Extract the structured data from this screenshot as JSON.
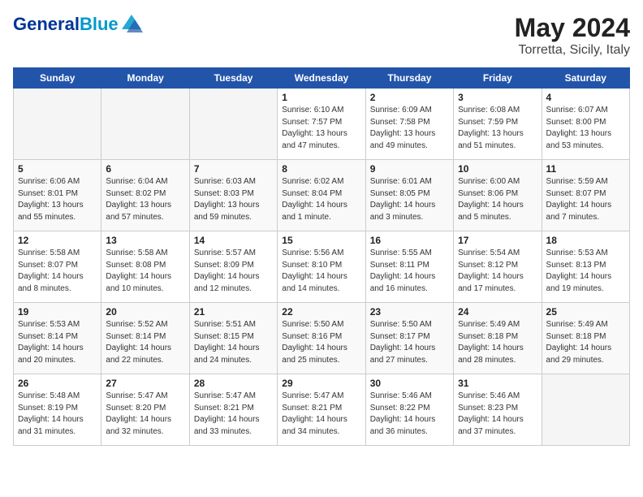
{
  "header": {
    "logo_line1": "General",
    "logo_line2": "Blue",
    "month_year": "May 2024",
    "location": "Torretta, Sicily, Italy"
  },
  "weekdays": [
    "Sunday",
    "Monday",
    "Tuesday",
    "Wednesday",
    "Thursday",
    "Friday",
    "Saturday"
  ],
  "weeks": [
    [
      {
        "day": "",
        "empty": true
      },
      {
        "day": "",
        "empty": true
      },
      {
        "day": "",
        "empty": true
      },
      {
        "day": "1",
        "sunrise": "Sunrise: 6:10 AM",
        "sunset": "Sunset: 7:57 PM",
        "daylight": "Daylight: 13 hours and 47 minutes."
      },
      {
        "day": "2",
        "sunrise": "Sunrise: 6:09 AM",
        "sunset": "Sunset: 7:58 PM",
        "daylight": "Daylight: 13 hours and 49 minutes."
      },
      {
        "day": "3",
        "sunrise": "Sunrise: 6:08 AM",
        "sunset": "Sunset: 7:59 PM",
        "daylight": "Daylight: 13 hours and 51 minutes."
      },
      {
        "day": "4",
        "sunrise": "Sunrise: 6:07 AM",
        "sunset": "Sunset: 8:00 PM",
        "daylight": "Daylight: 13 hours and 53 minutes."
      }
    ],
    [
      {
        "day": "5",
        "sunrise": "Sunrise: 6:06 AM",
        "sunset": "Sunset: 8:01 PM",
        "daylight": "Daylight: 13 hours and 55 minutes."
      },
      {
        "day": "6",
        "sunrise": "Sunrise: 6:04 AM",
        "sunset": "Sunset: 8:02 PM",
        "daylight": "Daylight: 13 hours and 57 minutes."
      },
      {
        "day": "7",
        "sunrise": "Sunrise: 6:03 AM",
        "sunset": "Sunset: 8:03 PM",
        "daylight": "Daylight: 13 hours and 59 minutes."
      },
      {
        "day": "8",
        "sunrise": "Sunrise: 6:02 AM",
        "sunset": "Sunset: 8:04 PM",
        "daylight": "Daylight: 14 hours and 1 minute."
      },
      {
        "day": "9",
        "sunrise": "Sunrise: 6:01 AM",
        "sunset": "Sunset: 8:05 PM",
        "daylight": "Daylight: 14 hours and 3 minutes."
      },
      {
        "day": "10",
        "sunrise": "Sunrise: 6:00 AM",
        "sunset": "Sunset: 8:06 PM",
        "daylight": "Daylight: 14 hours and 5 minutes."
      },
      {
        "day": "11",
        "sunrise": "Sunrise: 5:59 AM",
        "sunset": "Sunset: 8:07 PM",
        "daylight": "Daylight: 14 hours and 7 minutes."
      }
    ],
    [
      {
        "day": "12",
        "sunrise": "Sunrise: 5:58 AM",
        "sunset": "Sunset: 8:07 PM",
        "daylight": "Daylight: 14 hours and 8 minutes."
      },
      {
        "day": "13",
        "sunrise": "Sunrise: 5:58 AM",
        "sunset": "Sunset: 8:08 PM",
        "daylight": "Daylight: 14 hours and 10 minutes."
      },
      {
        "day": "14",
        "sunrise": "Sunrise: 5:57 AM",
        "sunset": "Sunset: 8:09 PM",
        "daylight": "Daylight: 14 hours and 12 minutes."
      },
      {
        "day": "15",
        "sunrise": "Sunrise: 5:56 AM",
        "sunset": "Sunset: 8:10 PM",
        "daylight": "Daylight: 14 hours and 14 minutes."
      },
      {
        "day": "16",
        "sunrise": "Sunrise: 5:55 AM",
        "sunset": "Sunset: 8:11 PM",
        "daylight": "Daylight: 14 hours and 16 minutes."
      },
      {
        "day": "17",
        "sunrise": "Sunrise: 5:54 AM",
        "sunset": "Sunset: 8:12 PM",
        "daylight": "Daylight: 14 hours and 17 minutes."
      },
      {
        "day": "18",
        "sunrise": "Sunrise: 5:53 AM",
        "sunset": "Sunset: 8:13 PM",
        "daylight": "Daylight: 14 hours and 19 minutes."
      }
    ],
    [
      {
        "day": "19",
        "sunrise": "Sunrise: 5:53 AM",
        "sunset": "Sunset: 8:14 PM",
        "daylight": "Daylight: 14 hours and 20 minutes."
      },
      {
        "day": "20",
        "sunrise": "Sunrise: 5:52 AM",
        "sunset": "Sunset: 8:14 PM",
        "daylight": "Daylight: 14 hours and 22 minutes."
      },
      {
        "day": "21",
        "sunrise": "Sunrise: 5:51 AM",
        "sunset": "Sunset: 8:15 PM",
        "daylight": "Daylight: 14 hours and 24 minutes."
      },
      {
        "day": "22",
        "sunrise": "Sunrise: 5:50 AM",
        "sunset": "Sunset: 8:16 PM",
        "daylight": "Daylight: 14 hours and 25 minutes."
      },
      {
        "day": "23",
        "sunrise": "Sunrise: 5:50 AM",
        "sunset": "Sunset: 8:17 PM",
        "daylight": "Daylight: 14 hours and 27 minutes."
      },
      {
        "day": "24",
        "sunrise": "Sunrise: 5:49 AM",
        "sunset": "Sunset: 8:18 PM",
        "daylight": "Daylight: 14 hours and 28 minutes."
      },
      {
        "day": "25",
        "sunrise": "Sunrise: 5:49 AM",
        "sunset": "Sunset: 8:18 PM",
        "daylight": "Daylight: 14 hours and 29 minutes."
      }
    ],
    [
      {
        "day": "26",
        "sunrise": "Sunrise: 5:48 AM",
        "sunset": "Sunset: 8:19 PM",
        "daylight": "Daylight: 14 hours and 31 minutes."
      },
      {
        "day": "27",
        "sunrise": "Sunrise: 5:47 AM",
        "sunset": "Sunset: 8:20 PM",
        "daylight": "Daylight: 14 hours and 32 minutes."
      },
      {
        "day": "28",
        "sunrise": "Sunrise: 5:47 AM",
        "sunset": "Sunset: 8:21 PM",
        "daylight": "Daylight: 14 hours and 33 minutes."
      },
      {
        "day": "29",
        "sunrise": "Sunrise: 5:47 AM",
        "sunset": "Sunset: 8:21 PM",
        "daylight": "Daylight: 14 hours and 34 minutes."
      },
      {
        "day": "30",
        "sunrise": "Sunrise: 5:46 AM",
        "sunset": "Sunset: 8:22 PM",
        "daylight": "Daylight: 14 hours and 36 minutes."
      },
      {
        "day": "31",
        "sunrise": "Sunrise: 5:46 AM",
        "sunset": "Sunset: 8:23 PM",
        "daylight": "Daylight: 14 hours and 37 minutes."
      },
      {
        "day": "",
        "empty": true
      }
    ]
  ]
}
